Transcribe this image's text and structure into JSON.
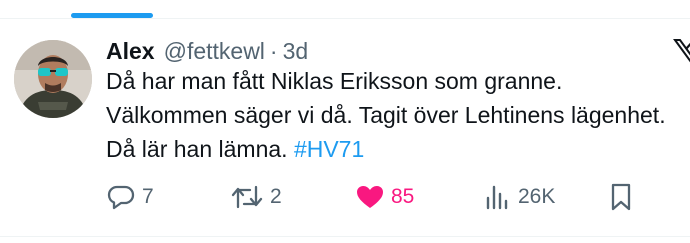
{
  "tweet": {
    "author_name": "Alex",
    "author_handle": "@fettkewl",
    "separator": "·",
    "timestamp": "3d",
    "text": "Då har man fått Niklas Eriksson som granne. Välkommen säger vi då. Tagit över Lehtinens lägenhet. Då lär han lämna.",
    "hashtag": "#HV71"
  },
  "actions": {
    "replies": "7",
    "reposts": "2",
    "likes": "85",
    "views": "26K",
    "liked": true
  },
  "colors": {
    "accent": "#1d9bf0",
    "like": "#f91880",
    "secondary_text": "#536471",
    "icon": "#536471"
  },
  "icons": [
    "avatar-photo",
    "x-logo-icon",
    "reply-icon",
    "repost-icon",
    "like-heart-icon",
    "views-icon",
    "bookmark-icon"
  ]
}
